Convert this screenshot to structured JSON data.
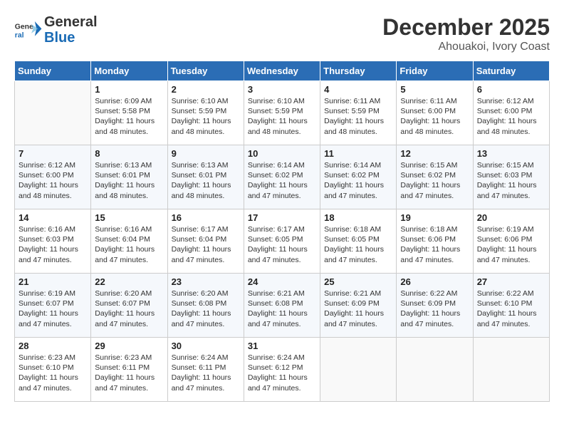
{
  "logo": {
    "general": "General",
    "blue": "Blue"
  },
  "header": {
    "month": "December 2025",
    "location": "Ahouakoi, Ivory Coast"
  },
  "weekdays": [
    "Sunday",
    "Monday",
    "Tuesday",
    "Wednesday",
    "Thursday",
    "Friday",
    "Saturday"
  ],
  "weeks": [
    [
      {
        "day": "",
        "empty": true
      },
      {
        "day": "1",
        "sunrise": "6:09 AM",
        "sunset": "5:58 PM",
        "daylight": "11 hours and 48 minutes."
      },
      {
        "day": "2",
        "sunrise": "6:10 AM",
        "sunset": "5:59 PM",
        "daylight": "11 hours and 48 minutes."
      },
      {
        "day": "3",
        "sunrise": "6:10 AM",
        "sunset": "5:59 PM",
        "daylight": "11 hours and 48 minutes."
      },
      {
        "day": "4",
        "sunrise": "6:11 AM",
        "sunset": "5:59 PM",
        "daylight": "11 hours and 48 minutes."
      },
      {
        "day": "5",
        "sunrise": "6:11 AM",
        "sunset": "6:00 PM",
        "daylight": "11 hours and 48 minutes."
      },
      {
        "day": "6",
        "sunrise": "6:12 AM",
        "sunset": "6:00 PM",
        "daylight": "11 hours and 48 minutes."
      }
    ],
    [
      {
        "day": "7",
        "sunrise": "6:12 AM",
        "sunset": "6:00 PM",
        "daylight": "11 hours and 48 minutes."
      },
      {
        "day": "8",
        "sunrise": "6:13 AM",
        "sunset": "6:01 PM",
        "daylight": "11 hours and 48 minutes."
      },
      {
        "day": "9",
        "sunrise": "6:13 AM",
        "sunset": "6:01 PM",
        "daylight": "11 hours and 48 minutes."
      },
      {
        "day": "10",
        "sunrise": "6:14 AM",
        "sunset": "6:02 PM",
        "daylight": "11 hours and 47 minutes."
      },
      {
        "day": "11",
        "sunrise": "6:14 AM",
        "sunset": "6:02 PM",
        "daylight": "11 hours and 47 minutes."
      },
      {
        "day": "12",
        "sunrise": "6:15 AM",
        "sunset": "6:02 PM",
        "daylight": "11 hours and 47 minutes."
      },
      {
        "day": "13",
        "sunrise": "6:15 AM",
        "sunset": "6:03 PM",
        "daylight": "11 hours and 47 minutes."
      }
    ],
    [
      {
        "day": "14",
        "sunrise": "6:16 AM",
        "sunset": "6:03 PM",
        "daylight": "11 hours and 47 minutes."
      },
      {
        "day": "15",
        "sunrise": "6:16 AM",
        "sunset": "6:04 PM",
        "daylight": "11 hours and 47 minutes."
      },
      {
        "day": "16",
        "sunrise": "6:17 AM",
        "sunset": "6:04 PM",
        "daylight": "11 hours and 47 minutes."
      },
      {
        "day": "17",
        "sunrise": "6:17 AM",
        "sunset": "6:05 PM",
        "daylight": "11 hours and 47 minutes."
      },
      {
        "day": "18",
        "sunrise": "6:18 AM",
        "sunset": "6:05 PM",
        "daylight": "11 hours and 47 minutes."
      },
      {
        "day": "19",
        "sunrise": "6:18 AM",
        "sunset": "6:06 PM",
        "daylight": "11 hours and 47 minutes."
      },
      {
        "day": "20",
        "sunrise": "6:19 AM",
        "sunset": "6:06 PM",
        "daylight": "11 hours and 47 minutes."
      }
    ],
    [
      {
        "day": "21",
        "sunrise": "6:19 AM",
        "sunset": "6:07 PM",
        "daylight": "11 hours and 47 minutes."
      },
      {
        "day": "22",
        "sunrise": "6:20 AM",
        "sunset": "6:07 PM",
        "daylight": "11 hours and 47 minutes."
      },
      {
        "day": "23",
        "sunrise": "6:20 AM",
        "sunset": "6:08 PM",
        "daylight": "11 hours and 47 minutes."
      },
      {
        "day": "24",
        "sunrise": "6:21 AM",
        "sunset": "6:08 PM",
        "daylight": "11 hours and 47 minutes."
      },
      {
        "day": "25",
        "sunrise": "6:21 AM",
        "sunset": "6:09 PM",
        "daylight": "11 hours and 47 minutes."
      },
      {
        "day": "26",
        "sunrise": "6:22 AM",
        "sunset": "6:09 PM",
        "daylight": "11 hours and 47 minutes."
      },
      {
        "day": "27",
        "sunrise": "6:22 AM",
        "sunset": "6:10 PM",
        "daylight": "11 hours and 47 minutes."
      }
    ],
    [
      {
        "day": "28",
        "sunrise": "6:23 AM",
        "sunset": "6:10 PM",
        "daylight": "11 hours and 47 minutes."
      },
      {
        "day": "29",
        "sunrise": "6:23 AM",
        "sunset": "6:11 PM",
        "daylight": "11 hours and 47 minutes."
      },
      {
        "day": "30",
        "sunrise": "6:24 AM",
        "sunset": "6:11 PM",
        "daylight": "11 hours and 47 minutes."
      },
      {
        "day": "31",
        "sunrise": "6:24 AM",
        "sunset": "6:12 PM",
        "daylight": "11 hours and 47 minutes."
      },
      {
        "day": "",
        "empty": true
      },
      {
        "day": "",
        "empty": true
      },
      {
        "day": "",
        "empty": true
      }
    ]
  ]
}
